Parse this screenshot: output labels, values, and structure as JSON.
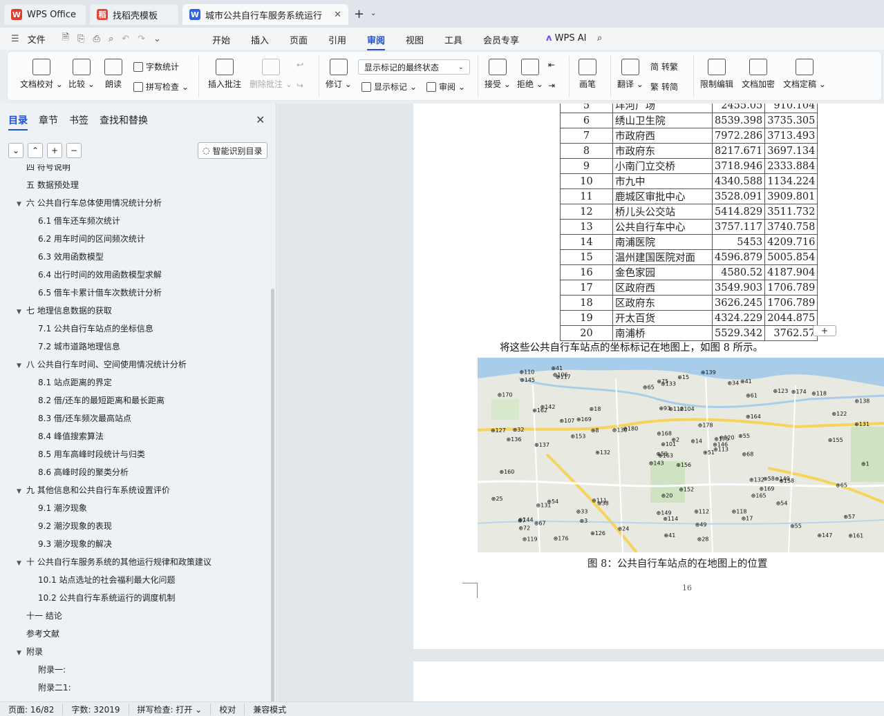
{
  "tabs": [
    {
      "label": "WPS Office",
      "icon": "wps-logo-icon"
    },
    {
      "label": "找稻壳模板",
      "icon": "docer-icon"
    },
    {
      "label": "城市公共自行车服务系统运行",
      "icon": "writer-doc-icon"
    }
  ],
  "menubar": {
    "file_label": "文件",
    "menus": [
      "开始",
      "插入",
      "页面",
      "引用",
      "审阅",
      "视图",
      "工具",
      "会员专享"
    ],
    "active_menu": "审阅",
    "ai_label": "WPS AI"
  },
  "ribbon": {
    "doc_proof": "文档校对",
    "compare": "比较",
    "read_aloud": "朗读",
    "word_count": "字数统计",
    "spell_check": "拼写检查",
    "insert_comment": "插入批注",
    "delete_comment": "删除批注",
    "track_changes": "修订",
    "display_state": "显示标记的最终状态",
    "show_markup": "显示标记",
    "review_pane": "审阅",
    "accept": "接受",
    "reject": "拒绝",
    "pen": "画笔",
    "translate": "翻译",
    "to_traditional": "转繁",
    "to_simplified": "转简",
    "restrict_edit": "限制编辑",
    "encrypt": "文档加密",
    "finalize": "文档定稿"
  },
  "sidebar": {
    "tabs": [
      "目录",
      "章节",
      "书签",
      "查找和替换"
    ],
    "active_tab": "目录",
    "smart_toc": "智能识别目录",
    "toc": [
      {
        "text": "四  符号说明",
        "level": 1,
        "expand": false
      },
      {
        "text": "五  数据预处理",
        "level": 1,
        "expand": false
      },
      {
        "text": "六  公共自行车总体使用情况统计分析",
        "level": 1,
        "expand": true
      },
      {
        "text": "6.1 借车还车频次统计",
        "level": 2,
        "expand": false
      },
      {
        "text": "6.2 用车时间的区间频次统计",
        "level": 2,
        "expand": false
      },
      {
        "text": "6.3 效用函数模型",
        "level": 2,
        "expand": false
      },
      {
        "text": "6.4 出行时间的效用函数模型求解",
        "level": 2,
        "expand": false
      },
      {
        "text": "6.5 借车卡累计借车次数统计分析",
        "level": 2,
        "expand": false
      },
      {
        "text": "七  地理信息数据的获取",
        "level": 1,
        "expand": true
      },
      {
        "text": "7.1 公共自行车站点的坐标信息",
        "level": 2,
        "expand": false
      },
      {
        "text": "7.2 城市道路地理信息",
        "level": 2,
        "expand": false
      },
      {
        "text": "八  公共自行车时间、空间使用情况统计分析",
        "level": 1,
        "expand": true
      },
      {
        "text": "8.1  站点距离的界定",
        "level": 2,
        "expand": false
      },
      {
        "text": "8.2  借/还车的最短距离和最长距离",
        "level": 2,
        "expand": false
      },
      {
        "text": "8.3  借/还车频次最高站点",
        "level": 2,
        "expand": false
      },
      {
        "text": "8.4  峰值搜索算法",
        "level": 2,
        "expand": false
      },
      {
        "text": "8.5 用车高峰时段统计与归类",
        "level": 2,
        "expand": false
      },
      {
        "text": "8.6  高峰时段的聚类分析",
        "level": 2,
        "expand": false
      },
      {
        "text": "九  其他信息和公共自行车系统设置评价",
        "level": 1,
        "expand": true
      },
      {
        "text": "9.1  潮汐现象",
        "level": 2,
        "expand": false
      },
      {
        "text": "9.2  潮汐现象的表现",
        "level": 2,
        "expand": false
      },
      {
        "text": "9.3  潮汐现象的解决",
        "level": 2,
        "expand": false
      },
      {
        "text": "十  公共自行车服务系统的其他运行规律和政策建议",
        "level": 1,
        "expand": true
      },
      {
        "text": "10.1  站点选址的社会福利最大化问题",
        "level": 2,
        "expand": false
      },
      {
        "text": "10.2  公共自行车系统运行的调度机制",
        "level": 2,
        "expand": false
      },
      {
        "text": "十一  结论",
        "level": 1,
        "expand": false
      },
      {
        "text": "参考文献",
        "level": 1,
        "expand": false
      },
      {
        "text": "附录",
        "level": 1,
        "expand": true
      },
      {
        "text": "附录一:",
        "level": 2,
        "expand": false
      },
      {
        "text": "附录二1:",
        "level": 2,
        "expand": false
      }
    ]
  },
  "document": {
    "table_rows": [
      [
        "5",
        "垟河广场",
        "2455.05",
        "910.104"
      ],
      [
        "6",
        "绣山卫生院",
        "8539.398",
        "3735.305"
      ],
      [
        "7",
        "市政府西",
        "7972.286",
        "3713.493"
      ],
      [
        "8",
        "市政府东",
        "8217.671",
        "3697.134"
      ],
      [
        "9",
        "小南门立交桥",
        "3718.946",
        "2333.884"
      ],
      [
        "10",
        "市九中",
        "4340.588",
        "1134.224"
      ],
      [
        "11",
        "鹿城区审批中心",
        "3528.091",
        "3909.801"
      ],
      [
        "12",
        "桥儿头公交站",
        "5414.829",
        "3511.732"
      ],
      [
        "13",
        "公共自行车中心",
        "3757.117",
        "3740.758"
      ],
      [
        "14",
        "南浦医院",
        "5453",
        "4209.716"
      ],
      [
        "15",
        "温州建国医院对面",
        "4596.879",
        "5005.854"
      ],
      [
        "16",
        "金色家园",
        "4580.52",
        "4187.904"
      ],
      [
        "17",
        "区政府西",
        "3549.903",
        "1706.789"
      ],
      [
        "18",
        "区政府东",
        "3626.245",
        "1706.789"
      ],
      [
        "19",
        "开太百货",
        "4324.229",
        "2044.875"
      ],
      [
        "20",
        "南浦桥",
        "5529.342",
        "3762.57"
      ]
    ],
    "paragraph": "将这些公共自行车站点的坐标标记在地图上，如图 8 所示。",
    "caption": "图 8：公共自行车站点的在地图上的位置",
    "page_number": "16",
    "map_labels": [
      "156",
      "162",
      "163",
      "144",
      "175",
      "38",
      "41",
      "104",
      "61",
      "51",
      "117",
      "161",
      "137",
      "138",
      "143",
      "164",
      "176",
      "93",
      "178",
      "54",
      "180",
      "72",
      "3",
      "112",
      "120",
      "158",
      "142",
      "133",
      "136",
      "132",
      "131",
      "59",
      "149",
      "101",
      "18",
      "123",
      "111",
      "147",
      "57",
      "140",
      "139",
      "130",
      "153",
      "165",
      "126",
      "127",
      "146",
      "119",
      "114",
      "113",
      "131",
      "122",
      "170",
      "169",
      "17",
      "33",
      "106",
      "110",
      "112",
      "118",
      "15",
      "132",
      "32",
      "169",
      "174",
      "41",
      "34",
      "65",
      "2",
      "25",
      "20",
      "24",
      "58",
      "8",
      "7",
      "145",
      "107",
      "160",
      "168",
      "49",
      "14",
      "67",
      "68",
      "65",
      "41",
      "155",
      "152",
      "55",
      "28",
      "118",
      "75",
      "1",
      "55",
      "54"
    ]
  },
  "statusbar": {
    "page": "页面: 16/82",
    "words": "字数: 32019",
    "spell": "拼写检查: 打开",
    "proof": "校对",
    "compat": "兼容模式"
  }
}
